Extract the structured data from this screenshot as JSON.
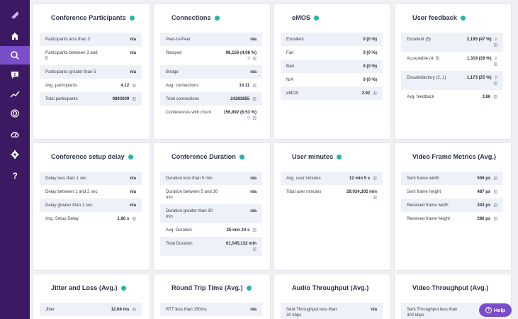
{
  "sidebar": {
    "icons": [
      "logo-icon",
      "home-icon",
      "analytics-icon",
      "feedback-icon",
      "trend-icon",
      "fingerprint-icon",
      "gauge-icon",
      "settings-icon",
      "help-question-icon"
    ]
  },
  "cards": {
    "participants": {
      "title": "Conference Participants",
      "rows": [
        {
          "label": "Participants less than 3",
          "value": "n/a"
        },
        {
          "label": "Participants between 3 and 5",
          "value": "n/a"
        },
        {
          "label": "Participants greater than 5",
          "value": "n/a"
        },
        {
          "label": "Avg. participants",
          "value": "4.12"
        },
        {
          "label": "Total participants",
          "value": "9893009"
        }
      ]
    },
    "connections": {
      "title": "Connections",
      "rows": [
        {
          "label": "Peer-to-Peer",
          "value": "n/a"
        },
        {
          "label": "Relayed",
          "value": "98,156 (4.08 %)"
        },
        {
          "label": "Bridge",
          "value": "n/a"
        },
        {
          "label": "Avg. connections",
          "value": "10.11"
        },
        {
          "label": "Total connections",
          "value": "24283855"
        },
        {
          "label": "Conferences with churn",
          "value": "156,892 (6.53 %)"
        }
      ]
    },
    "emos": {
      "title": "eMOS",
      "rows": [
        {
          "label": "Excellent",
          "value": "0 (0 %)"
        },
        {
          "label": "Fair",
          "value": "0 (0 %)"
        },
        {
          "label": "Bad",
          "value": "0 (0 %)"
        },
        {
          "label": "N/A",
          "value": "0 (0 %)"
        },
        {
          "label": "eMOS",
          "value": "2.92"
        }
      ]
    },
    "feedback": {
      "title": "User feedback",
      "rows": [
        {
          "label": "Excellent (5)",
          "value": "2,195 (47 %)"
        },
        {
          "label": "Acceptable (4, 3)",
          "value": "1,319 (28 %)"
        },
        {
          "label": "Dissatisfactory (2, 1)",
          "value": "1,173 (25 %)"
        },
        {
          "label": "Avg. feedback",
          "value": "3.66"
        }
      ]
    },
    "setup_delay": {
      "title": "Conference setup delay",
      "rows": [
        {
          "label": "Delay less than 1 sec",
          "value": "n/a"
        },
        {
          "label": "Delay between 1 and 2 sec",
          "value": "n/a"
        },
        {
          "label": "Delay greater than 2 sec",
          "value": "n/a"
        },
        {
          "label": "Avg. Setup Delay",
          "value": "1.86 s"
        }
      ]
    },
    "duration": {
      "title": "Conference Duration",
      "rows": [
        {
          "label": "Duration less than 5 min",
          "value": "n/a"
        },
        {
          "label": "Duration between 5 and 30 min",
          "value": "n/a"
        },
        {
          "label": "Duration greater than 30 min",
          "value": "n/a"
        },
        {
          "label": "Avg. Duration",
          "value": "25 min 24 s"
        },
        {
          "label": "Total Duration",
          "value": "61,045,132 min"
        }
      ]
    },
    "user_minutes": {
      "title": "User minutes",
      "rows": [
        {
          "label": "Avg. user minutes",
          "value": "12 min 5 s"
        },
        {
          "label": "Total user minutes",
          "value": "29,034,302 min"
        }
      ]
    },
    "video_frame": {
      "title": "Video Frame Metrics (Avg.)",
      "rows": [
        {
          "label": "Sent frame width",
          "value": "559 px"
        },
        {
          "label": "Sent frame height",
          "value": "487 px"
        },
        {
          "label": "Received frame width",
          "value": "343 px"
        },
        {
          "label": "Received frame height",
          "value": "286 px"
        }
      ]
    },
    "jitter": {
      "title": "Jitter and Loss (Avg.)",
      "rows": [
        {
          "label": "Jitter",
          "value": "12.64 ms"
        }
      ]
    },
    "rtt": {
      "title": "Round Trip Time (Avg.)",
      "rows": [
        {
          "label": "RTT less than 150ms",
          "value": "n/a"
        }
      ]
    },
    "audio_throughput": {
      "title": "Audio Throughput (Avg.)",
      "rows": [
        {
          "label": "Sent Throughput less than 30 kbps",
          "value": "n/a"
        }
      ]
    },
    "video_throughput": {
      "title": "Video Throughput (Avg.)",
      "rows": [
        {
          "label": "Sent Throughput less than 300 kbps",
          "value": ""
        }
      ]
    }
  },
  "help_button": {
    "label": "Help"
  },
  "colors": {
    "sidebar": "#3b1a63",
    "accent": "#7b4ec9",
    "info_dot": "#20b8a4"
  }
}
